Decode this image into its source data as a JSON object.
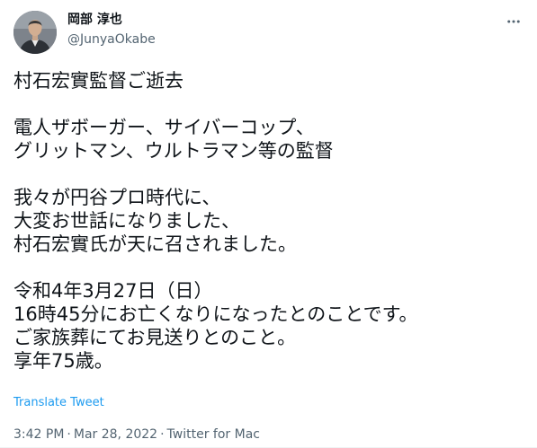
{
  "author": {
    "display_name": "岡部 淳也",
    "handle": "@JunyaOkabe"
  },
  "tweet": {
    "text": "村石宏實監督ご逝去\n\n電人ザボーガー、サイバーコップ、\nグリットマン、ウルトラマン等の監督\n\n我々が円谷プロ時代に、\n大変お世話になりました、\n村石宏實氏が天に召されました。\n\n令和4年3月27日（日）\n16時45分にお亡くなりになったとのことです。\nご家族葬にてお見送りとのこと。\n享年75歳。",
    "translate_label": "Translate Tweet"
  },
  "meta": {
    "time": "3:42 PM",
    "separator": "·",
    "date": "Mar 28, 2022",
    "source": "Twitter for Mac"
  },
  "icons": {
    "more": "more-horizontal-icon",
    "avatar": "profile-photo"
  },
  "colors": {
    "link": "#1d9bf0",
    "secondary_text": "#536471",
    "primary_text": "#0f1419"
  }
}
